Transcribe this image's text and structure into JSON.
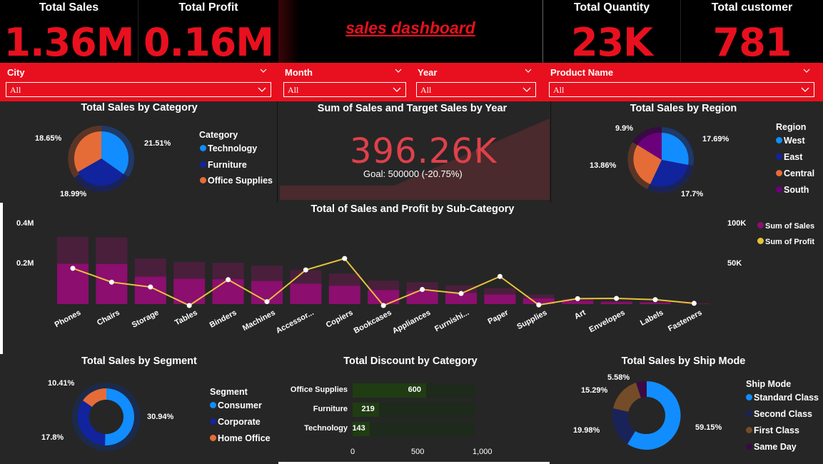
{
  "kpis": {
    "total_sales": {
      "title": "Total Sales",
      "value": "1.36M"
    },
    "total_profit": {
      "title": "Total Profit",
      "value": "0.16M"
    },
    "total_quantity": {
      "title": "Total Quantity",
      "value": "23K"
    },
    "total_customer": {
      "title": "Total customer",
      "value": "781"
    }
  },
  "dashboard_title": "sales dashboard",
  "filters": {
    "city": {
      "label": "City",
      "value": "All"
    },
    "month": {
      "label": "Month",
      "value": "All"
    },
    "year": {
      "label": "Year",
      "value": "All"
    },
    "product_name": {
      "label": "Product Name",
      "value": "All"
    }
  },
  "colors": {
    "accent": "#e8101e",
    "blue": "#118dff",
    "navy": "#12239e",
    "orange": "#e66c37",
    "purple": "#6b007b",
    "brown": "#744c28",
    "bar": "#8c0e6f",
    "line": "#e5c33a"
  },
  "category_pie": {
    "title": "Total Sales by Category",
    "legend_title": "Category",
    "legend": [
      "Technology",
      "Furniture",
      "Office Supplies"
    ],
    "labels": {
      "technology": "21.51%",
      "furniture": "18.99%",
      "office": "18.65%"
    }
  },
  "gauge": {
    "title": "Sum of Sales and Target Sales by Year",
    "value": "396.26K",
    "goal": "Goal: 500000 (-20.75%)",
    "flag": "!"
  },
  "region_pie": {
    "title": "Total Sales by Region",
    "legend_title": "Region",
    "legend": [
      "West",
      "East",
      "Central",
      "South"
    ],
    "labels": {
      "west": "17.69%",
      "east": "17.7%",
      "central": "13.86%",
      "south": "9.9%"
    }
  },
  "subcat_chart": {
    "title": "Total of Sales and Profit by Sub-Category",
    "y_left_ticks": [
      "0.4M",
      "0.2M"
    ],
    "y_right_ticks": [
      "100K",
      "50K"
    ],
    "legend": [
      "Sum of Sales",
      "Sum of Profit"
    ]
  },
  "segment_donut": {
    "title": "Total Sales by Segment",
    "legend_title": "Segment",
    "legend": [
      "Consumer",
      "Corporate",
      "Home Office"
    ],
    "labels": {
      "consumer": "30.94%",
      "corporate": "17.8%",
      "home_office": "10.41%"
    }
  },
  "discount_bar": {
    "title": "Total Discount by Category",
    "x_ticks": [
      "0",
      "500",
      "1,000"
    ]
  },
  "shipmode_donut": {
    "title": "Total Sales by Ship Mode",
    "legend_title": "Ship Mode",
    "legend": [
      "Standard Class",
      "Second Class",
      "First Class",
      "Same Day"
    ],
    "labels": {
      "standard": "59.15%",
      "second": "19.98%",
      "first": "15.29%",
      "same_day": "5.58%"
    }
  },
  "chart_data": [
    {
      "type": "bar",
      "title": "Total of Sales and Profit by Sub-Category",
      "categories": [
        "Phones",
        "Chairs",
        "Storage",
        "Tables",
        "Binders",
        "Machines",
        "Accessor...",
        "Copiers",
        "Bookcases",
        "Appliances",
        "Furnishi...",
        "Paper",
        "Supplies",
        "Art",
        "Envelopes",
        "Labels",
        "Fasteners"
      ],
      "series": [
        {
          "name": "Sum of Sales",
          "axis": "left",
          "values": [
            330000,
            328000,
            224000,
            207000,
            203000,
            189000,
            167000,
            150000,
            115000,
            108000,
            92000,
            78000,
            47000,
            27000,
            16000,
            12000,
            3000
          ]
        },
        {
          "name": "Sum of Profit",
          "axis": "right",
          "values": [
            44000,
            27000,
            21000,
            -18000,
            30000,
            3000,
            42000,
            56000,
            -3000,
            18000,
            13000,
            34000,
            -1000,
            6700,
            7000,
            5500,
            950
          ]
        }
      ],
      "ylim_left": [
        0,
        400000
      ],
      "ylim_right": [
        0,
        100000
      ]
    },
    {
      "type": "bar",
      "title": "Total Discount by Category",
      "categories": [
        "Office Supplies",
        "Furniture",
        "Technology"
      ],
      "values": [
        600,
        219,
        143
      ],
      "xlim": [
        0,
        1000
      ]
    },
    {
      "type": "pie",
      "title": "Total Sales by Category",
      "categories": [
        "Technology",
        "Furniture",
        "Office Supplies"
      ],
      "values": [
        21.51,
        18.99,
        18.65
      ]
    },
    {
      "type": "pie",
      "title": "Total Sales by Region",
      "categories": [
        "West",
        "East",
        "Central",
        "South"
      ],
      "values": [
        17.69,
        17.7,
        13.86,
        9.9
      ]
    },
    {
      "type": "pie",
      "title": "Total Sales by Segment",
      "categories": [
        "Consumer",
        "Corporate",
        "Home Office"
      ],
      "values": [
        30.94,
        17.8,
        10.41
      ]
    },
    {
      "type": "pie",
      "title": "Total Sales by Ship Mode",
      "categories": [
        "Standard Class",
        "Second Class",
        "First Class",
        "Same Day"
      ],
      "values": [
        59.15,
        19.98,
        15.29,
        5.58
      ]
    }
  ]
}
